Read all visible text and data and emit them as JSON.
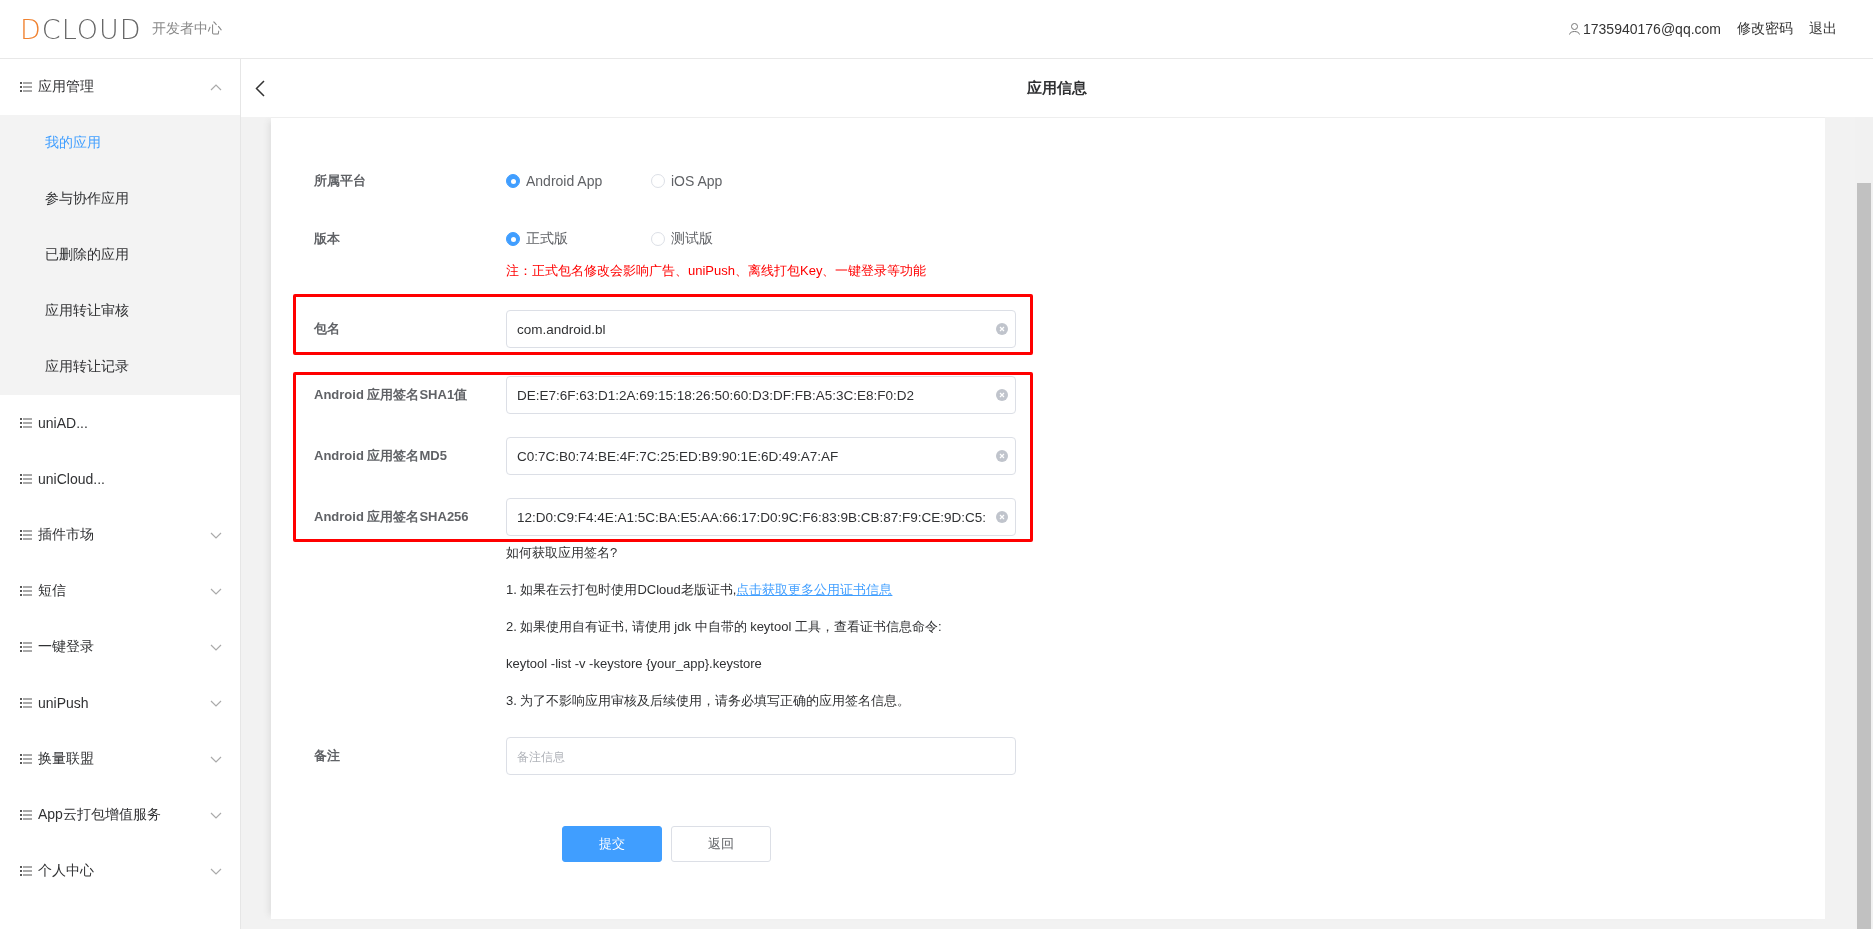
{
  "header": {
    "logo": "DCLOUD",
    "subtitle": "开发者中心",
    "user": "1735940176@qq.com",
    "links": [
      "修改密码",
      "退出"
    ]
  },
  "sidebar": {
    "items": [
      {
        "label": "应用管理",
        "kind": "group",
        "expanded": true,
        "children": [
          {
            "label": "我的应用",
            "selected": true
          },
          {
            "label": "参与协作应用",
            "selected": false
          },
          {
            "label": "已删除的应用",
            "selected": false
          },
          {
            "label": "应用转让审核",
            "selected": false
          },
          {
            "label": "应用转让记录",
            "selected": false
          }
        ]
      },
      {
        "label": "uniAD...",
        "kind": "link"
      },
      {
        "label": "uniCloud...",
        "kind": "link"
      },
      {
        "label": "插件市场",
        "kind": "group",
        "expanded": false
      },
      {
        "label": "短信",
        "kind": "group",
        "expanded": false
      },
      {
        "label": "一键登录",
        "kind": "group",
        "expanded": false
      },
      {
        "label": "uniPush",
        "kind": "group",
        "expanded": false
      },
      {
        "label": "换量联盟",
        "kind": "group",
        "expanded": false
      },
      {
        "label": "App云打包增值服务",
        "kind": "group",
        "expanded": false
      },
      {
        "label": "个人中心",
        "kind": "group",
        "expanded": false
      }
    ]
  },
  "page_title": "应用信息",
  "form": {
    "platform": {
      "label": "所属平台",
      "options": [
        {
          "label": "Android App",
          "selected": true
        },
        {
          "label": "iOS App",
          "selected": false
        }
      ]
    },
    "version": {
      "label": "版本",
      "options": [
        {
          "label": "正式版",
          "selected": true
        },
        {
          "label": "测试版",
          "selected": false
        }
      ],
      "note": "注：正式包名修改会影响广告、uniPush、离线打包Key、一键登录等功能"
    },
    "framed_groups": [
      {
        "fields": [
          {
            "label": "包名",
            "value": "com.android.bl"
          }
        ]
      },
      {
        "fields": [
          {
            "label": "Android 应用签名SHA1值",
            "value": "DE:E7:6F:63:D1:2A:69:15:18:26:50:60:D3:DF:FB:A5:3C:E8:F0:D2"
          },
          {
            "label": "Android 应用签名MD5",
            "value": "C0:7C:B0:74:BE:4F:7C:25:ED:B9:90:1E:6D:49:A7:AF"
          },
          {
            "label": "Android 应用签名SHA256",
            "value": "12:D0:C9:F4:4E:A1:5C:BA:E5:AA:66:17:D0:9C:F6:83:9B:CB:87:F9:CE:9D:C5:"
          }
        ]
      }
    ],
    "help": {
      "title": "如何获取应用签名?",
      "lines": [
        {
          "text": "1. 如果在云打包时使用DCloud老版证书,",
          "link": "点击获取更多公用证书信息"
        },
        {
          "text": "2. 如果使用自有证书, 请使用 jdk 中自带的 keytool 工具，查看证书信息命令:"
        },
        {
          "text": "keytool -list -v -keystore {your_app}.keystore"
        },
        {
          "text": "3. 为了不影响应用审核及后续使用，请务必填写正确的应用签名信息。"
        }
      ]
    },
    "remark": {
      "label": "备注",
      "placeholder": "备注信息"
    },
    "buttons": [
      {
        "label": "提交",
        "kind": "primary"
      },
      {
        "label": "返回",
        "kind": "default"
      }
    ]
  }
}
